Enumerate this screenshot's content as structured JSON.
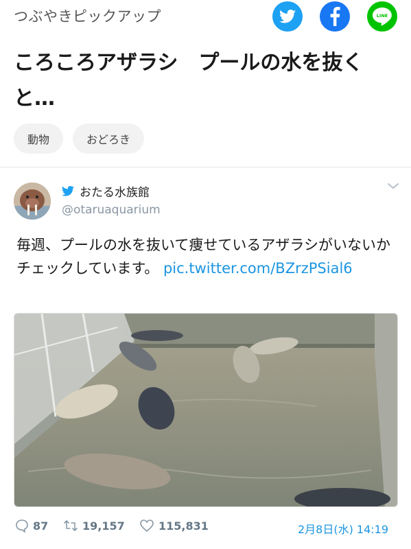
{
  "header": {
    "section_label": "つぶやきピックアップ",
    "share_buttons": [
      {
        "name": "twitter",
        "color": "#1da1f2",
        "icon": "twitter-bird-icon"
      },
      {
        "name": "facebook",
        "color": "#1877f2",
        "icon": "facebook-f-icon"
      },
      {
        "name": "line",
        "color": "#00c300",
        "icon": "line-icon",
        "label": "LINE"
      }
    ]
  },
  "article": {
    "title": "ころころアザラシ　プールの水を抜くと…",
    "tags": [
      "動物",
      "おどろき"
    ]
  },
  "tweet": {
    "display_name": "おたる水族館",
    "handle": "@otaruaquarium",
    "text_body": "毎週、プールの水を抜いて痩せているアザラシがいないかチェックしています。",
    "link_text": "pic.twitter.com/BZrzPSial6",
    "replies": "87",
    "retweets": "19,157",
    "likes": "115,831",
    "timestamp": "2月8日(水) 14:19",
    "accent_color": "#1b95e0"
  }
}
